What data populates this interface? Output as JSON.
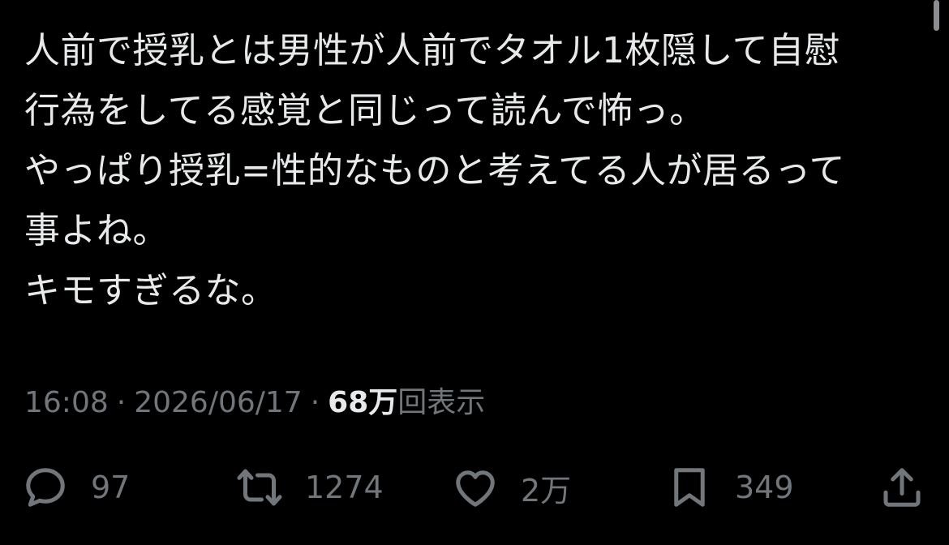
{
  "tweet": {
    "lines": [
      "人前で授乳とは男性が人前でタオル1枚隠して自慰",
      "行為をしてる感覚と同じって読んで怖っ。",
      "やっぱり授乳=性的なものと考えてる人が居るって",
      "事よね。",
      "キモすぎるな。"
    ]
  },
  "meta": {
    "time": "16:08",
    "separator": "·",
    "date": "2026/06/17",
    "views_count": "68万",
    "views_label": "回表示"
  },
  "actions": {
    "reply": {
      "count": "97",
      "icon": "reply-icon"
    },
    "retweet": {
      "count": "1274",
      "icon": "retweet-icon"
    },
    "like": {
      "count": "2万",
      "icon": "heart-icon"
    },
    "bookmark": {
      "count": "349",
      "icon": "bookmark-icon"
    },
    "share": {
      "icon": "share-icon"
    }
  },
  "colors": {
    "background": "#000000",
    "text": "#e7e9ea",
    "muted": "#71767b"
  }
}
